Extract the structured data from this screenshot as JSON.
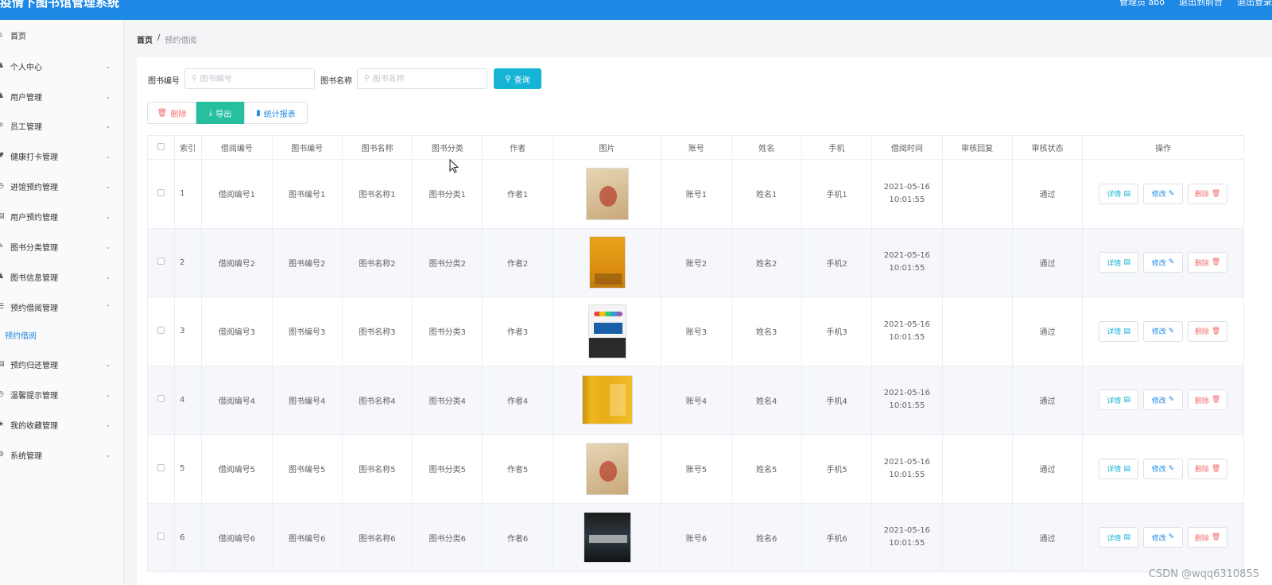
{
  "header": {
    "title": "疫情下图书馆管理系统",
    "admin_label": "管理员 abo",
    "back_front_label": "退出到前台",
    "logout_label": "退出登录"
  },
  "sidebar": {
    "items": [
      {
        "label": "首页",
        "icon": "home-icon",
        "has_arrow": false
      },
      {
        "label": "个人中心",
        "icon": "user-icon",
        "has_arrow": true
      },
      {
        "label": "用户管理",
        "icon": "users-icon",
        "has_arrow": true
      },
      {
        "label": "员工管理",
        "icon": "staff-icon",
        "has_arrow": true
      },
      {
        "label": "健康打卡管理",
        "icon": "health-icon",
        "has_arrow": true
      },
      {
        "label": "进馆预约管理",
        "icon": "clock-icon",
        "has_arrow": true
      },
      {
        "label": "用户预约管理",
        "icon": "calendar-icon",
        "has_arrow": true
      },
      {
        "label": "图书分类管理",
        "icon": "category-icon",
        "has_arrow": true
      },
      {
        "label": "图书信息管理",
        "icon": "book-icon",
        "has_arrow": true
      },
      {
        "label": "预约借阅管理",
        "icon": "borrow-icon",
        "has_arrow": true,
        "expanded": true
      },
      {
        "label": "预约归还管理",
        "icon": "return-icon",
        "has_arrow": true
      },
      {
        "label": "温馨提示管理",
        "icon": "tip-icon",
        "has_arrow": true
      },
      {
        "label": "我的收藏管理",
        "icon": "star-icon",
        "has_arrow": true
      },
      {
        "label": "系统管理",
        "icon": "settings-icon",
        "has_arrow": true
      }
    ],
    "active_subitem": "预约借阅"
  },
  "breadcrumb": {
    "home": "首页",
    "separator": "/",
    "current": "预约借阅"
  },
  "search": {
    "book_no_label": "图书编号",
    "book_no_placeholder": "图书编号",
    "book_name_label": "图书名称",
    "book_name_placeholder": "图书名称",
    "query_label": "查询"
  },
  "actions": {
    "delete_label": "删除",
    "export_label": "导出",
    "report_label": "统计报表"
  },
  "table": {
    "headers": [
      "索引",
      "借阅编号",
      "图书编号",
      "图书名称",
      "图书分类",
      "作者",
      "图片",
      "账号",
      "姓名",
      "手机",
      "借阅时间",
      "审核回复",
      "审核状态",
      "操作"
    ],
    "row_actions": {
      "detail": "详情",
      "edit": "修改",
      "delete": "删除"
    },
    "rows": [
      {
        "index": "1",
        "borrow_no": "借阅编号1",
        "book_no": "图书编号1",
        "book_name": "图书名称1",
        "category": "图书分类1",
        "author": "作者1",
        "cover": "c1",
        "account": "账号1",
        "name": "姓名1",
        "phone": "手机1",
        "time": "2021-05-16 10:01:55",
        "reply": "",
        "status": "通过"
      },
      {
        "index": "2",
        "borrow_no": "借阅编号2",
        "book_no": "图书编号2",
        "book_name": "图书名称2",
        "category": "图书分类2",
        "author": "作者2",
        "cover": "c2",
        "account": "账号2",
        "name": "姓名2",
        "phone": "手机2",
        "time": "2021-05-16 10:01:55",
        "reply": "",
        "status": "通过"
      },
      {
        "index": "3",
        "borrow_no": "借阅编号3",
        "book_no": "图书编号3",
        "book_name": "图书名称3",
        "category": "图书分类3",
        "author": "作者3",
        "cover": "c3",
        "account": "账号3",
        "name": "姓名3",
        "phone": "手机3",
        "time": "2021-05-16 10:01:55",
        "reply": "",
        "status": "通过"
      },
      {
        "index": "4",
        "borrow_no": "借阅编号4",
        "book_no": "图书编号4",
        "book_name": "图书名称4",
        "category": "图书分类4",
        "author": "作者4",
        "cover": "c4",
        "account": "账号4",
        "name": "姓名4",
        "phone": "手机4",
        "time": "2021-05-16 10:01:55",
        "reply": "",
        "status": "通过"
      },
      {
        "index": "5",
        "borrow_no": "借阅编号5",
        "book_no": "图书编号5",
        "book_name": "图书名称5",
        "category": "图书分类5",
        "author": "作者5",
        "cover": "c1",
        "account": "账号5",
        "name": "姓名5",
        "phone": "手机5",
        "time": "2021-05-16 10:01:55",
        "reply": "",
        "status": "通过"
      },
      {
        "index": "6",
        "borrow_no": "借阅编号6",
        "book_no": "图书编号6",
        "book_name": "图书名称6",
        "category": "图书分类6",
        "author": "作者6",
        "cover": "c6",
        "account": "账号6",
        "name": "姓名6",
        "phone": "手机6",
        "time": "2021-05-16 10:01:55",
        "reply": "",
        "status": "通过"
      }
    ]
  },
  "watermark": "CSDN @wqq6310855",
  "colors": {
    "primary": "#1e88e5",
    "query": "#17b3d6",
    "export": "#26bfa0",
    "danger": "#f56c6c"
  }
}
